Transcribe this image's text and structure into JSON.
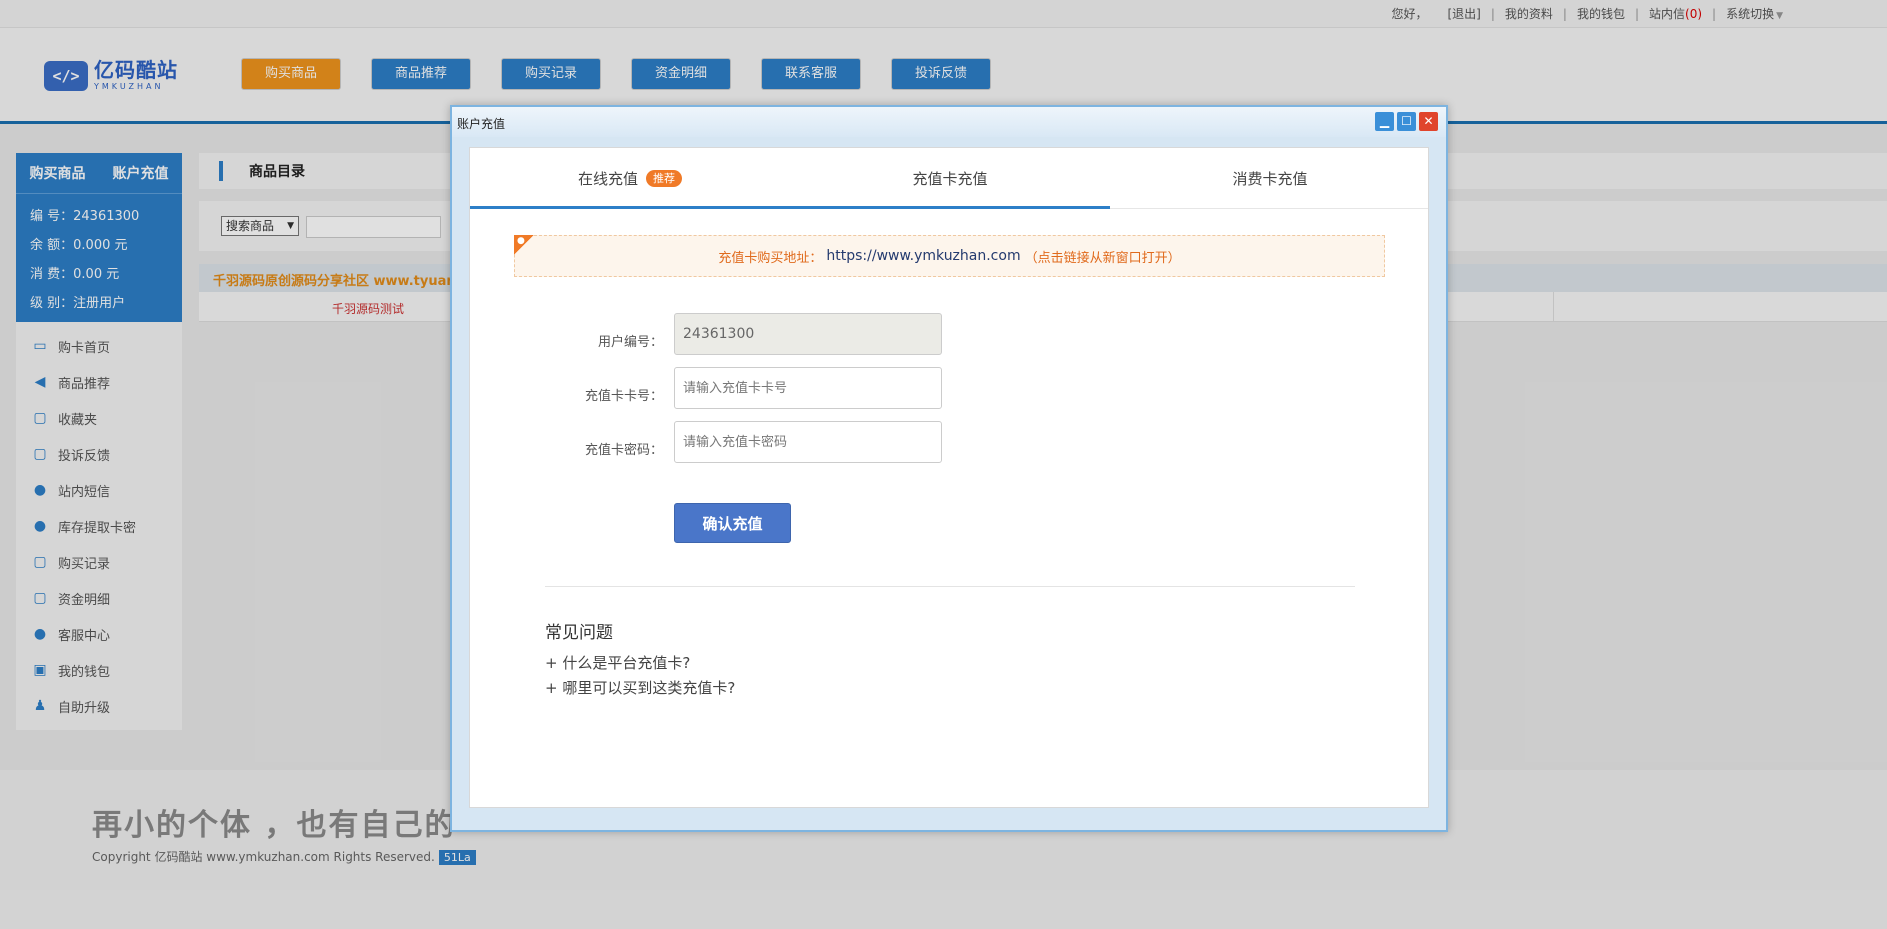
{
  "topbar": {
    "greeting": "您好，",
    "logout": "[退出]",
    "profile": "我的资料",
    "wallet": "我的钱包",
    "messages": "站内信",
    "messages_count": "(0)",
    "system_switch": "系统切换"
  },
  "logo": {
    "mark": "</>",
    "cn": "亿码酷站",
    "en": "YMKUZHAN"
  },
  "nav": {
    "buy": "购买商品",
    "recommend": "商品推荐",
    "records": "购买记录",
    "funds": "资金明细",
    "service": "联系客服",
    "complaint": "投诉反馈"
  },
  "sidebar": {
    "tab_buy": "购买商品",
    "tab_recharge": "账户充值",
    "info": {
      "id_label": "编 号：",
      "id_value": "24361300",
      "balance_label": "余 额：",
      "balance_value": "0.000 元",
      "spent_label": "消 费：",
      "spent_value": "0.00 元",
      "level_label": "级 别：",
      "level_value": "注册用户"
    },
    "menu": [
      "购卡首页",
      "商品推荐",
      "收藏夹",
      "投诉反馈",
      "站内短信",
      "库存提取卡密",
      "购买记录",
      "资金明细",
      "客服中心",
      "我的钱包",
      "自助升级"
    ]
  },
  "main": {
    "title": "商品目录",
    "search_select": "搜索商品",
    "notice": "千羽源码原创源码分享社区 www.tyuan",
    "row_cell": "千羽源码测试"
  },
  "footer": {
    "slogan": "再小的个体 ，也有自己的",
    "copyright": "Copyright 亿码酷站 www.ymkuzhan.com Rights Reserved.",
    "badge": "51La"
  },
  "modal": {
    "title": "账户充值",
    "tabs": {
      "online": "在线充值",
      "online_badge": "推荐",
      "card": "充值卡充值",
      "consume": "消费卡充值"
    },
    "addr_prefix": "充值卡购买地址：",
    "addr_url": "https://www.ymkuzhan.com",
    "addr_suffix": "（点击链接从新窗口打开）",
    "form": {
      "user_id_label": "用户编号：",
      "user_id_value": "24361300",
      "card_no_label": "充值卡卡号：",
      "card_no_placeholder": "请输入充值卡卡号",
      "card_pwd_label": "充值卡密码：",
      "card_pwd_placeholder": "请输入充值卡密码",
      "confirm": "确认充值"
    },
    "faq": {
      "title": "常见问题",
      "items": [
        "+ 什么是平台充值卡?",
        "+ 哪里可以买到这类充值卡?"
      ]
    }
  },
  "colors": {
    "primary": "#2d7fc8",
    "accent": "#f0941d",
    "close": "#e0442c"
  }
}
